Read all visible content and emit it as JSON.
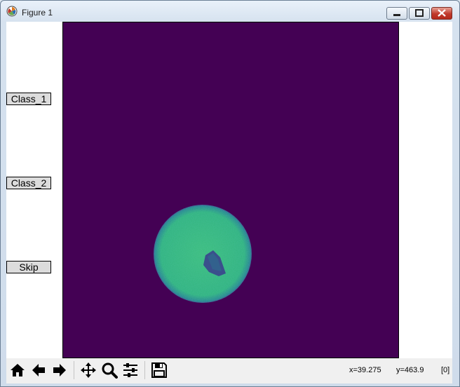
{
  "window": {
    "title": "Figure 1",
    "app_icon": "matplotlib-logo-icon",
    "controls": [
      "minimize-icon",
      "maximize-icon",
      "close-icon"
    ]
  },
  "side_buttons": [
    {
      "label": "Class_1"
    },
    {
      "label": "Class_2"
    },
    {
      "label": "Skip"
    }
  ],
  "image_view": {
    "colormap": "viridis",
    "background_color": "#440154",
    "disc_color": "#35b779",
    "inner_spot_color": "#2f4b8a"
  },
  "toolbar": {
    "buttons": [
      {
        "icon": "home-icon"
      },
      {
        "icon": "back-arrow-icon"
      },
      {
        "icon": "forward-arrow-icon"
      },
      {
        "icon": "pan-icon"
      },
      {
        "icon": "zoom-icon"
      },
      {
        "icon": "configure-subplots-icon"
      },
      {
        "icon": "save-icon"
      }
    ]
  },
  "status": {
    "x_readout": "x=39.275",
    "y_readout": "y=463.9",
    "value_readout": "[0]"
  }
}
